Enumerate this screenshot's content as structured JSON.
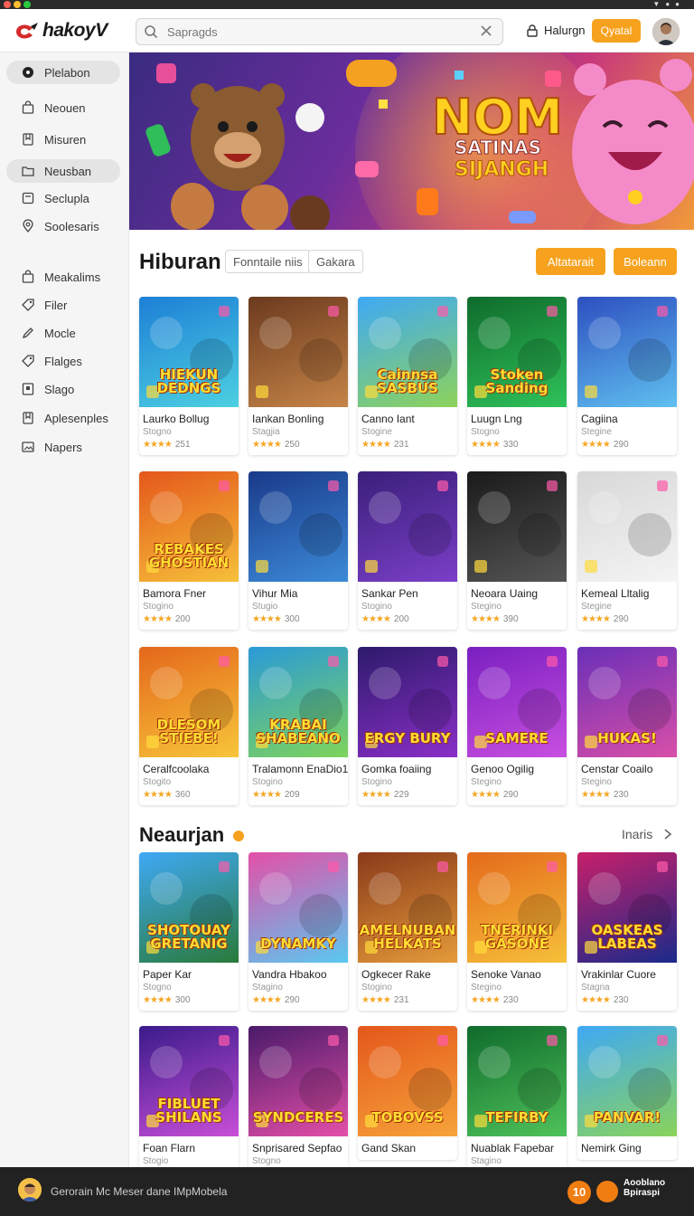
{
  "app": {
    "logo_text": "hakoyV"
  },
  "search": {
    "value": "",
    "placeholder": "Sapragds"
  },
  "header": {
    "link_label": "Halurgn",
    "button_label": "Qyatal"
  },
  "sidebar": {
    "items": [
      {
        "label": "Plelabon",
        "icon": "disc-icon",
        "active": true
      },
      {
        "label": "Neouen",
        "icon": "bag-icon"
      },
      {
        "label": "Misuren",
        "icon": "bookmark-icon"
      },
      {
        "label": "Neusban",
        "icon": "folder-icon",
        "active": true
      },
      {
        "label": "Seclupla",
        "icon": "square-icon"
      },
      {
        "label": "Soolesaris",
        "icon": "pin-icon"
      },
      {
        "label": "Meakalims",
        "icon": "bag-icon"
      },
      {
        "label": "Filer",
        "icon": "tag-icon"
      },
      {
        "label": "Mocle",
        "icon": "pencil-icon"
      },
      {
        "label": "Flalges",
        "icon": "tag-icon"
      },
      {
        "label": "Slago",
        "icon": "book-icon"
      },
      {
        "label": "Aplesenples",
        "icon": "bookmark-icon"
      },
      {
        "label": "Napers",
        "icon": "image-icon"
      }
    ]
  },
  "banner": {
    "title": "NOM",
    "subtitle_1": "SATINAS",
    "subtitle_2": "SIJANGH"
  },
  "section1": {
    "title": "Hiburan",
    "chips": [
      "Fonntaile niis",
      "Gakara"
    ],
    "buttons": [
      "Altatarait",
      "Boleann"
    ]
  },
  "section2": {
    "title": "Neaurjan",
    "more_label": "Inaris"
  },
  "cards": [
    {
      "name": "Laurko Bollug",
      "sub": "Stogno",
      "rating": "251",
      "art": "HIEKUN DEDNGS",
      "bg": "#1d7fd6",
      "bg2": "#4dd0e1"
    },
    {
      "name": "Iankan Bonling",
      "sub": "Stagjia",
      "rating": "250",
      "art": "",
      "bg": "#6b3a1e",
      "bg2": "#c68448"
    },
    {
      "name": "Canno Iant",
      "sub": "Stogine",
      "rating": "231",
      "art": "Cainnsa SASBUS",
      "bg": "#3fa9f5",
      "bg2": "#8dd35a"
    },
    {
      "name": "Luugn Lng",
      "sub": "Stogno",
      "rating": "330",
      "art": "Stoken Sanding",
      "bg": "#0f6b2c",
      "bg2": "#2fc25a"
    },
    {
      "name": "Cagiina",
      "sub": "Stegine",
      "rating": "290",
      "art": "",
      "bg": "#2d4fc0",
      "bg2": "#60c0f0"
    },
    {
      "name": "Bamora Fner",
      "sub": "Stogino",
      "rating": "200",
      "art": "REBAKES GHOSTIAN",
      "bg": "#e4571b",
      "bg2": "#f6c03a"
    },
    {
      "name": "Vihur Mia",
      "sub": "Stugio",
      "rating": "300",
      "art": "",
      "bg": "#1a3a8a",
      "bg2": "#3c8ad8"
    },
    {
      "name": "Sankar Pen",
      "sub": "Stogino",
      "rating": "200",
      "art": "",
      "bg": "#3b1f7a",
      "bg2": "#7a3fc8"
    },
    {
      "name": "Neoara Uaing",
      "sub": "Stegino",
      "rating": "390",
      "art": "",
      "bg": "#1a1a1a",
      "bg2": "#555555"
    },
    {
      "name": "Kemeal Lltalig",
      "sub": "Stegine",
      "rating": "290",
      "art": "",
      "bg": "#d8d8d8",
      "bg2": "#f4f4f4"
    },
    {
      "name": "Ceralfcoolaka",
      "sub": "Stogito",
      "rating": "360",
      "art": "DLESOM STIEBE!",
      "bg": "#e4671b",
      "bg2": "#f7c53a"
    },
    {
      "name": "Tralamonn EnaDio1",
      "sub": "Stogino",
      "rating": "209",
      "art": "KRABAI SHABEANO",
      "bg": "#2a9ad8",
      "bg2": "#7ed45a"
    },
    {
      "name": "Gomka foaiing",
      "sub": "Stogino",
      "rating": "229",
      "art": "ERGY BURY",
      "bg": "#2d1a6b",
      "bg2": "#8a2fc8"
    },
    {
      "name": "Genoo Ogilig",
      "sub": "Stegino",
      "rating": "290",
      "art": "SAMERE",
      "bg": "#7a1fc0",
      "bg2": "#c84fe0"
    },
    {
      "name": "Censtar Coailo",
      "sub": "Stegino",
      "rating": "230",
      "art": "HUKAS!",
      "bg": "#6a2fb8",
      "bg2": "#d84fa8"
    },
    {
      "name": "Paper Kar",
      "sub": "Stogno",
      "rating": "300",
      "art": "SHOTOUAY GRETANIG",
      "bg": "#3fa9f5",
      "bg2": "#2a7a3a"
    },
    {
      "name": "Vandra Hbakoo",
      "sub": "Stagino",
      "rating": "290",
      "art": "DYNAMKY",
      "bg": "#e44fa8",
      "bg2": "#5ac8f0"
    },
    {
      "name": "Ogkecer Rake",
      "sub": "Stogino",
      "rating": "231",
      "art": "AMELNUBAN HELKATS",
      "bg": "#8a3a1a",
      "bg2": "#e49a3a"
    },
    {
      "name": "Senoke Vanao",
      "sub": "Stegino",
      "rating": "230",
      "art": "TNERINKI GASONE",
      "bg": "#e46a1b",
      "bg2": "#f6c03a"
    },
    {
      "name": "Vrakinlar Cuore",
      "sub": "Stagna",
      "rating": "230",
      "art": "OASKEAS LABEAS",
      "bg": "#c81f6a",
      "bg2": "#1a2a8a"
    },
    {
      "name": "Foan Flarn",
      "sub": "Stogio",
      "rating": "",
      "art": "FIBLUET SHILANS",
      "bg": "#3a1a8a",
      "bg2": "#c84fd8"
    },
    {
      "name": "Snprisared Sepfao",
      "sub": "Stogno",
      "rating": "",
      "art": "SYNDCERES",
      "bg": "#4a1a6a",
      "bg2": "#e44fa8"
    },
    {
      "name": "Gand Skan",
      "sub": "",
      "rating": "",
      "art": "TOBOVSS",
      "bg": "#e4571b",
      "bg2": "#f6a33a"
    },
    {
      "name": "Nuablak Fapebar",
      "sub": "Stagino",
      "rating": "",
      "art": "TEFIRBY",
      "bg": "#0f6b2c",
      "bg2": "#4fc25a"
    },
    {
      "name": "Nemirk Ging",
      "sub": "",
      "rating": "",
      "art": "PANVAR!",
      "bg": "#3fa9f5",
      "bg2": "#8ad35a"
    }
  ],
  "bottombar": {
    "text": "Gerorain Mc Meser dane IMpMobela",
    "badge": "10",
    "brand_1": "Aooblano",
    "brand_2": "Bpiraspi"
  },
  "colors": {
    "accent": "#f7a21e",
    "sidebar_bg": "#f5f5f5",
    "bottombar_bg": "#222222"
  }
}
